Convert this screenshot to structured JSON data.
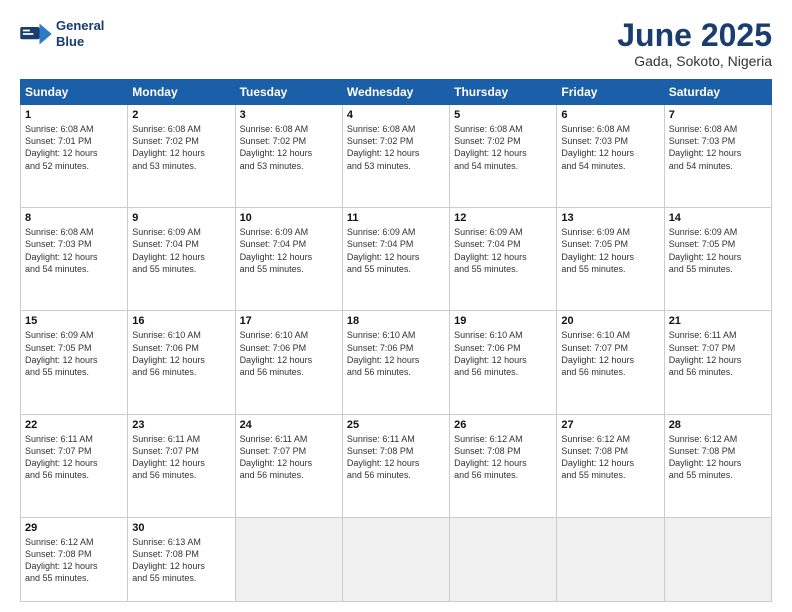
{
  "header": {
    "logo_line1": "General",
    "logo_line2": "Blue",
    "month": "June 2025",
    "location": "Gada, Sokoto, Nigeria"
  },
  "weekdays": [
    "Sunday",
    "Monday",
    "Tuesday",
    "Wednesday",
    "Thursday",
    "Friday",
    "Saturday"
  ],
  "weeks": [
    [
      {
        "day": "1",
        "lines": [
          "Sunrise: 6:08 AM",
          "Sunset: 7:01 PM",
          "Daylight: 12 hours",
          "and 52 minutes."
        ]
      },
      {
        "day": "2",
        "lines": [
          "Sunrise: 6:08 AM",
          "Sunset: 7:02 PM",
          "Daylight: 12 hours",
          "and 53 minutes."
        ]
      },
      {
        "day": "3",
        "lines": [
          "Sunrise: 6:08 AM",
          "Sunset: 7:02 PM",
          "Daylight: 12 hours",
          "and 53 minutes."
        ]
      },
      {
        "day": "4",
        "lines": [
          "Sunrise: 6:08 AM",
          "Sunset: 7:02 PM",
          "Daylight: 12 hours",
          "and 53 minutes."
        ]
      },
      {
        "day": "5",
        "lines": [
          "Sunrise: 6:08 AM",
          "Sunset: 7:02 PM",
          "Daylight: 12 hours",
          "and 54 minutes."
        ]
      },
      {
        "day": "6",
        "lines": [
          "Sunrise: 6:08 AM",
          "Sunset: 7:03 PM",
          "Daylight: 12 hours",
          "and 54 minutes."
        ]
      },
      {
        "day": "7",
        "lines": [
          "Sunrise: 6:08 AM",
          "Sunset: 7:03 PM",
          "Daylight: 12 hours",
          "and 54 minutes."
        ]
      }
    ],
    [
      {
        "day": "8",
        "lines": [
          "Sunrise: 6:08 AM",
          "Sunset: 7:03 PM",
          "Daylight: 12 hours",
          "and 54 minutes."
        ]
      },
      {
        "day": "9",
        "lines": [
          "Sunrise: 6:09 AM",
          "Sunset: 7:04 PM",
          "Daylight: 12 hours",
          "and 55 minutes."
        ]
      },
      {
        "day": "10",
        "lines": [
          "Sunrise: 6:09 AM",
          "Sunset: 7:04 PM",
          "Daylight: 12 hours",
          "and 55 minutes."
        ]
      },
      {
        "day": "11",
        "lines": [
          "Sunrise: 6:09 AM",
          "Sunset: 7:04 PM",
          "Daylight: 12 hours",
          "and 55 minutes."
        ]
      },
      {
        "day": "12",
        "lines": [
          "Sunrise: 6:09 AM",
          "Sunset: 7:04 PM",
          "Daylight: 12 hours",
          "and 55 minutes."
        ]
      },
      {
        "day": "13",
        "lines": [
          "Sunrise: 6:09 AM",
          "Sunset: 7:05 PM",
          "Daylight: 12 hours",
          "and 55 minutes."
        ]
      },
      {
        "day": "14",
        "lines": [
          "Sunrise: 6:09 AM",
          "Sunset: 7:05 PM",
          "Daylight: 12 hours",
          "and 55 minutes."
        ]
      }
    ],
    [
      {
        "day": "15",
        "lines": [
          "Sunrise: 6:09 AM",
          "Sunset: 7:05 PM",
          "Daylight: 12 hours",
          "and 55 minutes."
        ]
      },
      {
        "day": "16",
        "lines": [
          "Sunrise: 6:10 AM",
          "Sunset: 7:06 PM",
          "Daylight: 12 hours",
          "and 56 minutes."
        ]
      },
      {
        "day": "17",
        "lines": [
          "Sunrise: 6:10 AM",
          "Sunset: 7:06 PM",
          "Daylight: 12 hours",
          "and 56 minutes."
        ]
      },
      {
        "day": "18",
        "lines": [
          "Sunrise: 6:10 AM",
          "Sunset: 7:06 PM",
          "Daylight: 12 hours",
          "and 56 minutes."
        ]
      },
      {
        "day": "19",
        "lines": [
          "Sunrise: 6:10 AM",
          "Sunset: 7:06 PM",
          "Daylight: 12 hours",
          "and 56 minutes."
        ]
      },
      {
        "day": "20",
        "lines": [
          "Sunrise: 6:10 AM",
          "Sunset: 7:07 PM",
          "Daylight: 12 hours",
          "and 56 minutes."
        ]
      },
      {
        "day": "21",
        "lines": [
          "Sunrise: 6:11 AM",
          "Sunset: 7:07 PM",
          "Daylight: 12 hours",
          "and 56 minutes."
        ]
      }
    ],
    [
      {
        "day": "22",
        "lines": [
          "Sunrise: 6:11 AM",
          "Sunset: 7:07 PM",
          "Daylight: 12 hours",
          "and 56 minutes."
        ]
      },
      {
        "day": "23",
        "lines": [
          "Sunrise: 6:11 AM",
          "Sunset: 7:07 PM",
          "Daylight: 12 hours",
          "and 56 minutes."
        ]
      },
      {
        "day": "24",
        "lines": [
          "Sunrise: 6:11 AM",
          "Sunset: 7:07 PM",
          "Daylight: 12 hours",
          "and 56 minutes."
        ]
      },
      {
        "day": "25",
        "lines": [
          "Sunrise: 6:11 AM",
          "Sunset: 7:08 PM",
          "Daylight: 12 hours",
          "and 56 minutes."
        ]
      },
      {
        "day": "26",
        "lines": [
          "Sunrise: 6:12 AM",
          "Sunset: 7:08 PM",
          "Daylight: 12 hours",
          "and 56 minutes."
        ]
      },
      {
        "day": "27",
        "lines": [
          "Sunrise: 6:12 AM",
          "Sunset: 7:08 PM",
          "Daylight: 12 hours",
          "and 55 minutes."
        ]
      },
      {
        "day": "28",
        "lines": [
          "Sunrise: 6:12 AM",
          "Sunset: 7:08 PM",
          "Daylight: 12 hours",
          "and 55 minutes."
        ]
      }
    ],
    [
      {
        "day": "29",
        "lines": [
          "Sunrise: 6:12 AM",
          "Sunset: 7:08 PM",
          "Daylight: 12 hours",
          "and 55 minutes."
        ]
      },
      {
        "day": "30",
        "lines": [
          "Sunrise: 6:13 AM",
          "Sunset: 7:08 PM",
          "Daylight: 12 hours",
          "and 55 minutes."
        ]
      },
      {
        "day": "",
        "lines": []
      },
      {
        "day": "",
        "lines": []
      },
      {
        "day": "",
        "lines": []
      },
      {
        "day": "",
        "lines": []
      },
      {
        "day": "",
        "lines": []
      }
    ]
  ]
}
